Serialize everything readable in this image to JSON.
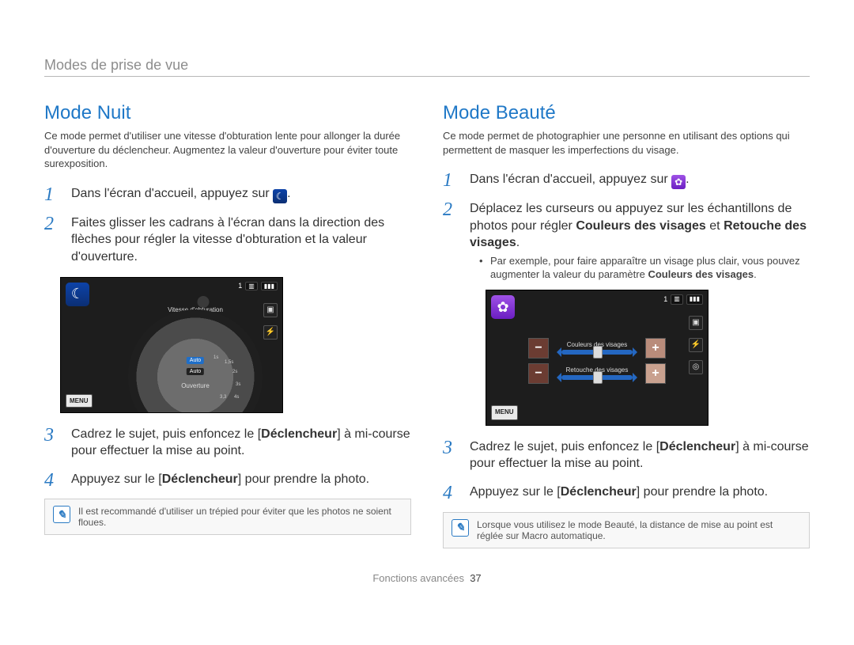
{
  "breadcrumb": "Modes de prise de vue",
  "left": {
    "title": "Mode Nuit",
    "intro": "Ce mode permet d'utiliser une vitesse d'obturation lente pour allonger la durée d'ouverture du déclencheur. Augmentez la valeur d'ouverture pour éviter toute surexposition.",
    "step1_pre": "Dans l'écran d'accueil, appuyez sur ",
    "step1_post": ".",
    "step2": "Faites glisser les cadrans à l'écran dans la direction des flèches pour régler la vitesse d'obturation et la valeur d'ouverture.",
    "step3_a": "Cadrez le sujet, puis enfoncez le [",
    "step3_b": "] à mi-course pour effectuer la mise au point.",
    "step4_a": "Appuyez sur le [",
    "step4_b": "] pour prendre la photo.",
    "declencheur": "Déclencheur",
    "note": "Il est recommandé d'utiliser un trépied pour éviter que les photos ne soient floues.",
    "lcd": {
      "mode_icon": "night-mode-icon",
      "shots": "1",
      "shutter_caption": "Vitesse d'obturation",
      "auto1": "Auto",
      "auto2": "Auto",
      "ouverture": "Ouverture",
      "ticks": [
        "1s",
        "1,5s",
        "2s",
        "3s",
        "4s",
        "3,3"
      ],
      "menu": "MENU"
    }
  },
  "right": {
    "title": "Mode Beauté",
    "intro": "Ce mode permet de photographier une personne en utilisant des options qui permettent de masquer les imperfections du visage.",
    "step1_pre": "Dans l'écran d'accueil, appuyez sur ",
    "step1_post": ".",
    "step2_a": "Déplacez les curseurs ou appuyez sur les échantillons de photos pour régler ",
    "step2_b": " et ",
    "step2_c": ".",
    "couleurs": "Couleurs des visages",
    "retouche": "Retouche des visages",
    "sub_a": "Par exemple, pour faire apparaître un visage plus clair, vous pouvez augmenter la valeur du paramètre ",
    "sub_b": ".",
    "sub_strong": "Couleurs des visages",
    "step3_a": "Cadrez le sujet, puis enfoncez le [",
    "step3_b": "] à mi-course pour effectuer la mise au point.",
    "step4_a": "Appuyez sur le [",
    "step4_b": "] pour prendre la photo.",
    "declencheur": "Déclencheur",
    "note": "Lorsque vous utilisez le mode Beauté, la distance de mise au point est réglée sur Macro automatique.",
    "lcd": {
      "mode_icon": "beauty-mode-icon",
      "shots": "1",
      "slider1_label": "Couleurs des visages",
      "slider2_label": "Retouche des visages",
      "menu": "MENU"
    }
  },
  "footer": {
    "section": "Fonctions avancées",
    "page": "37"
  }
}
